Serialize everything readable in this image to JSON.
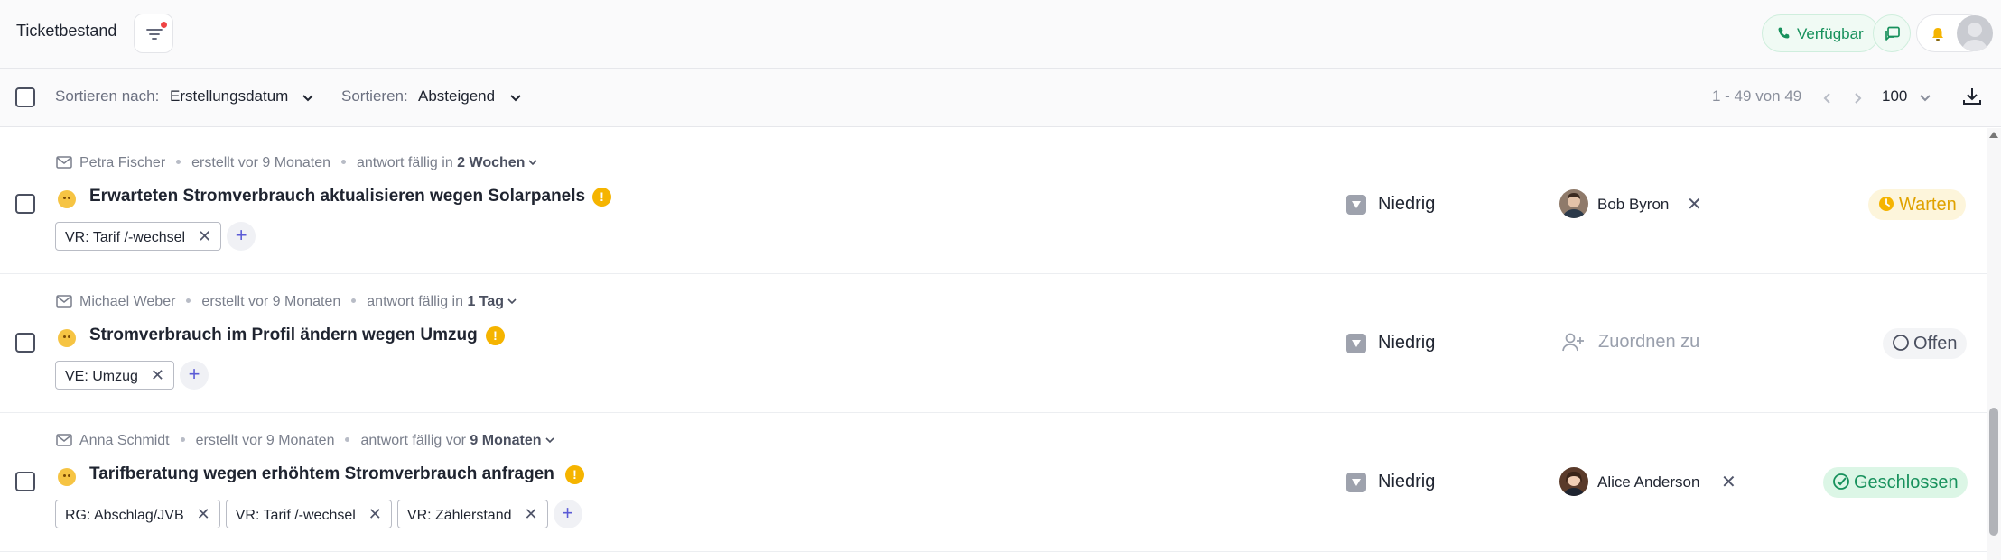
{
  "header": {
    "title": "Ticketbestand",
    "availability_label": "Verfügbar",
    "colors": {
      "available": "#17915c",
      "notification_dot": "#ef4444"
    },
    "icons": [
      "filter-icon",
      "phone-icon",
      "chat-icon",
      "bell-icon"
    ]
  },
  "toolbar": {
    "sort_by_label": "Sortieren nach:",
    "sort_by_value": "Erstellungsdatum",
    "sort_order_label": "Sortieren:",
    "sort_order_value": "Absteigend",
    "pager_text": "1 - 49 von 49",
    "page_size": "100"
  },
  "tickets": [
    {
      "requester": "Petra Fischer",
      "created": "erstellt vor 9 Monaten",
      "due_prefix": "antwort fällig in",
      "due_value": "2 Wochen",
      "title": "Erwarteten Stromverbrauch aktualisieren wegen Solarpanels",
      "tags": [
        "VR: Tarif /-wechsel"
      ],
      "priority": "Niedrig",
      "assignee": "Bob Byron",
      "status": "Warten",
      "status_color": "#e0a200"
    },
    {
      "requester": "Michael Weber",
      "created": "erstellt vor 9 Monaten",
      "due_prefix": "antwort fällig in",
      "due_value": "1 Tag",
      "title": "Stromverbrauch im Profil ändern wegen Umzug",
      "tags": [
        "VE: Umzug"
      ],
      "priority": "Niedrig",
      "assignee_placeholder": "Zuordnen zu",
      "status": "Offen",
      "status_color": "#4b5060"
    },
    {
      "requester": "Anna Schmidt",
      "created": "erstellt vor 9 Monaten",
      "due_prefix": "antwort fällig vor",
      "due_value": "9 Monaten",
      "title": "Tarifberatung wegen erhöhtem Stromverbrauch anfragen",
      "tags": [
        "RG: Abschlag/JVB",
        "VR: Tarif /-wechsel",
        "VR: Zählerstand"
      ],
      "priority": "Niedrig",
      "assignee": "Alice Anderson",
      "status": "Geschlossen",
      "status_color": "#17915c"
    }
  ]
}
